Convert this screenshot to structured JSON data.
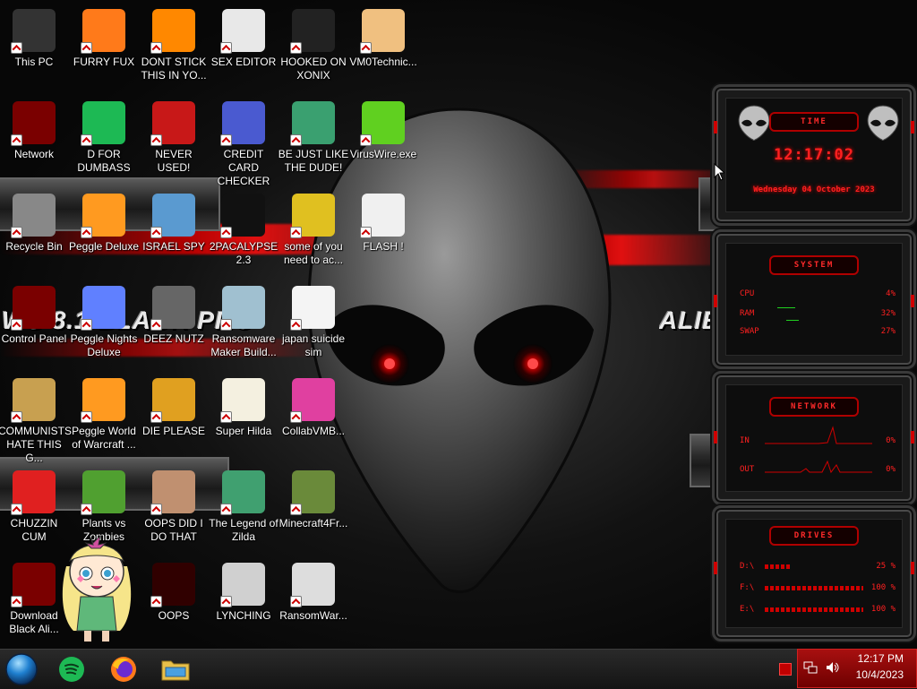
{
  "wallpaper": {
    "left_text": "WS 8.1 BLACK PRO",
    "right_text": "ALIENWARE"
  },
  "desktop_icons": [
    {
      "label": "This PC",
      "icon": "this-pc-icon"
    },
    {
      "label": "FURRY FUX",
      "icon": "firefox-icon"
    },
    {
      "label": "DONT STICK THIS IN YO...",
      "icon": "vlc-cone-icon"
    },
    {
      "label": "SEX EDITOR",
      "icon": "hxd-editor-icon"
    },
    {
      "label": "HOOKED ON XONIX",
      "icon": "xonix-game-icon"
    },
    {
      "label": "VM0Technic...",
      "icon": "doctor-person-icon"
    },
    {
      "label": "Network",
      "icon": "alien-network-icon"
    },
    {
      "label": "D FOR DUMBASS",
      "icon": "spotify-icon"
    },
    {
      "label": "NEVER USED!",
      "icon": "devcpp-icon"
    },
    {
      "label": "CREDIT CARD CHECKER",
      "icon": "credit-card-icon"
    },
    {
      "label": "BE JUST LIKE THE DUDE!",
      "icon": "elf-dude-icon"
    },
    {
      "label": "VirusWire.exe",
      "icon": "limewire-icon"
    },
    {
      "label": "Recycle Bin",
      "icon": "recycle-bin-icon"
    },
    {
      "label": "Peggle Deluxe",
      "icon": "peggle-icon"
    },
    {
      "label": "ISRAEL SPY",
      "icon": "spy-computer-icon"
    },
    {
      "label": "2PACALYPSE 2.3",
      "icon": "terminal-icon"
    },
    {
      "label": "some of you need to ac...",
      "icon": "dog-meme-icon"
    },
    {
      "label": "FLASH !",
      "icon": "flash-document-icon"
    },
    {
      "label": "Control Panel",
      "icon": "control-panel-icon"
    },
    {
      "label": "Peggle Nights Deluxe",
      "icon": "peggle-nights-icon"
    },
    {
      "label": "DEEZ NUTZ",
      "icon": "stacked-windows-icon"
    },
    {
      "label": "Ransomware Maker Build...",
      "icon": "ransomware-builder-icon"
    },
    {
      "label": "japan suicide sim",
      "icon": "document-icon"
    },
    {
      "label": "COMMUNISTS HATE THIS G...",
      "icon": "money-bag-icon"
    },
    {
      "label": "Peggle World of Warcraft ...",
      "icon": "peggle-wow-icon"
    },
    {
      "label": "DIE PLEASE",
      "icon": "after-effects-icon"
    },
    {
      "label": "Super Hilda",
      "icon": "pixel-character-icon"
    },
    {
      "label": "CollabVMB...",
      "icon": "collabvm-icon"
    },
    {
      "label": "CHUZZIN CUM",
      "icon": "chuzzle-icon"
    },
    {
      "label": "Plants vs Zombies",
      "icon": "plants-vs-zombies-icon"
    },
    {
      "label": "OOPS DID I DO THAT",
      "icon": "portrait-lady-icon"
    },
    {
      "label": "The Legend of Zilda",
      "icon": "zelda-sprite-icon"
    },
    {
      "label": "Minecraft4Fr...",
      "icon": "minecraft-block-icon"
    },
    {
      "label": "Download Black Ali...",
      "icon": "alien-download-icon"
    },
    {
      "label": "OOPS",
      "icon": "red-laptop-icon"
    },
    {
      "label": "LYNCHING",
      "icon": "rope-icon"
    },
    {
      "label": "RansomWar...",
      "icon": "skull-ring-icon"
    }
  ],
  "widgets": {
    "time": {
      "title": "TIME",
      "clock": "12:17:02",
      "date": "Wednesday 04 October 2023"
    },
    "system": {
      "title": "SYSTEM",
      "rows": [
        {
          "label": "CPU",
          "value": "4%"
        },
        {
          "label": "RAM",
          "value": "32%"
        },
        {
          "label": "SWAP",
          "value": "27%"
        }
      ]
    },
    "network": {
      "title": "NETWORK",
      "rows": [
        {
          "label": "IN",
          "value": "0%"
        },
        {
          "label": "OUT",
          "value": "0%"
        }
      ]
    },
    "drives": {
      "title": "DRIVES",
      "rows": [
        {
          "label": "D:\\",
          "value": "25 %",
          "fill": 0.25
        },
        {
          "label": "F:\\",
          "value": "100 %",
          "fill": 1.0
        },
        {
          "label": "E:\\",
          "value": "100 %",
          "fill": 1.0
        }
      ]
    }
  },
  "taskbar": {
    "items": [
      {
        "name": "start-orb",
        "icon": "start-orb-icon"
      },
      {
        "name": "spotify",
        "icon": "spotify-icon"
      },
      {
        "name": "firefox",
        "icon": "firefox-icon"
      },
      {
        "name": "file-explorer",
        "icon": "folder-icon"
      }
    ],
    "clock_time": "12:17 PM",
    "clock_date": "10/4/2023"
  },
  "colors": {
    "accent_red": "#ff2020",
    "tray_red": "#a81010"
  }
}
